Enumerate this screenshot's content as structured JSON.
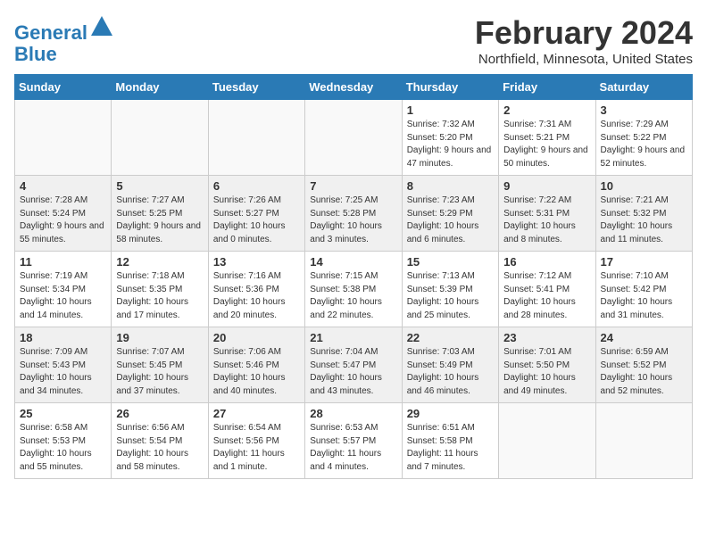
{
  "header": {
    "logo_line1": "General",
    "logo_line2": "Blue",
    "title": "February 2024",
    "subtitle": "Northfield, Minnesota, United States"
  },
  "columns": [
    "Sunday",
    "Monday",
    "Tuesday",
    "Wednesday",
    "Thursday",
    "Friday",
    "Saturday"
  ],
  "weeks": [
    [
      {
        "day": "",
        "info": ""
      },
      {
        "day": "",
        "info": ""
      },
      {
        "day": "",
        "info": ""
      },
      {
        "day": "",
        "info": ""
      },
      {
        "day": "1",
        "info": "Sunrise: 7:32 AM\nSunset: 5:20 PM\nDaylight: 9 hours and 47 minutes."
      },
      {
        "day": "2",
        "info": "Sunrise: 7:31 AM\nSunset: 5:21 PM\nDaylight: 9 hours and 50 minutes."
      },
      {
        "day": "3",
        "info": "Sunrise: 7:29 AM\nSunset: 5:22 PM\nDaylight: 9 hours and 52 minutes."
      }
    ],
    [
      {
        "day": "4",
        "info": "Sunrise: 7:28 AM\nSunset: 5:24 PM\nDaylight: 9 hours and 55 minutes."
      },
      {
        "day": "5",
        "info": "Sunrise: 7:27 AM\nSunset: 5:25 PM\nDaylight: 9 hours and 58 minutes."
      },
      {
        "day": "6",
        "info": "Sunrise: 7:26 AM\nSunset: 5:27 PM\nDaylight: 10 hours and 0 minutes."
      },
      {
        "day": "7",
        "info": "Sunrise: 7:25 AM\nSunset: 5:28 PM\nDaylight: 10 hours and 3 minutes."
      },
      {
        "day": "8",
        "info": "Sunrise: 7:23 AM\nSunset: 5:29 PM\nDaylight: 10 hours and 6 minutes."
      },
      {
        "day": "9",
        "info": "Sunrise: 7:22 AM\nSunset: 5:31 PM\nDaylight: 10 hours and 8 minutes."
      },
      {
        "day": "10",
        "info": "Sunrise: 7:21 AM\nSunset: 5:32 PM\nDaylight: 10 hours and 11 minutes."
      }
    ],
    [
      {
        "day": "11",
        "info": "Sunrise: 7:19 AM\nSunset: 5:34 PM\nDaylight: 10 hours and 14 minutes."
      },
      {
        "day": "12",
        "info": "Sunrise: 7:18 AM\nSunset: 5:35 PM\nDaylight: 10 hours and 17 minutes."
      },
      {
        "day": "13",
        "info": "Sunrise: 7:16 AM\nSunset: 5:36 PM\nDaylight: 10 hours and 20 minutes."
      },
      {
        "day": "14",
        "info": "Sunrise: 7:15 AM\nSunset: 5:38 PM\nDaylight: 10 hours and 22 minutes."
      },
      {
        "day": "15",
        "info": "Sunrise: 7:13 AM\nSunset: 5:39 PM\nDaylight: 10 hours and 25 minutes."
      },
      {
        "day": "16",
        "info": "Sunrise: 7:12 AM\nSunset: 5:41 PM\nDaylight: 10 hours and 28 minutes."
      },
      {
        "day": "17",
        "info": "Sunrise: 7:10 AM\nSunset: 5:42 PM\nDaylight: 10 hours and 31 minutes."
      }
    ],
    [
      {
        "day": "18",
        "info": "Sunrise: 7:09 AM\nSunset: 5:43 PM\nDaylight: 10 hours and 34 minutes."
      },
      {
        "day": "19",
        "info": "Sunrise: 7:07 AM\nSunset: 5:45 PM\nDaylight: 10 hours and 37 minutes."
      },
      {
        "day": "20",
        "info": "Sunrise: 7:06 AM\nSunset: 5:46 PM\nDaylight: 10 hours and 40 minutes."
      },
      {
        "day": "21",
        "info": "Sunrise: 7:04 AM\nSunset: 5:47 PM\nDaylight: 10 hours and 43 minutes."
      },
      {
        "day": "22",
        "info": "Sunrise: 7:03 AM\nSunset: 5:49 PM\nDaylight: 10 hours and 46 minutes."
      },
      {
        "day": "23",
        "info": "Sunrise: 7:01 AM\nSunset: 5:50 PM\nDaylight: 10 hours and 49 minutes."
      },
      {
        "day": "24",
        "info": "Sunrise: 6:59 AM\nSunset: 5:52 PM\nDaylight: 10 hours and 52 minutes."
      }
    ],
    [
      {
        "day": "25",
        "info": "Sunrise: 6:58 AM\nSunset: 5:53 PM\nDaylight: 10 hours and 55 minutes."
      },
      {
        "day": "26",
        "info": "Sunrise: 6:56 AM\nSunset: 5:54 PM\nDaylight: 10 hours and 58 minutes."
      },
      {
        "day": "27",
        "info": "Sunrise: 6:54 AM\nSunset: 5:56 PM\nDaylight: 11 hours and 1 minute."
      },
      {
        "day": "28",
        "info": "Sunrise: 6:53 AM\nSunset: 5:57 PM\nDaylight: 11 hours and 4 minutes."
      },
      {
        "day": "29",
        "info": "Sunrise: 6:51 AM\nSunset: 5:58 PM\nDaylight: 11 hours and 7 minutes."
      },
      {
        "day": "",
        "info": ""
      },
      {
        "day": "",
        "info": ""
      }
    ]
  ]
}
